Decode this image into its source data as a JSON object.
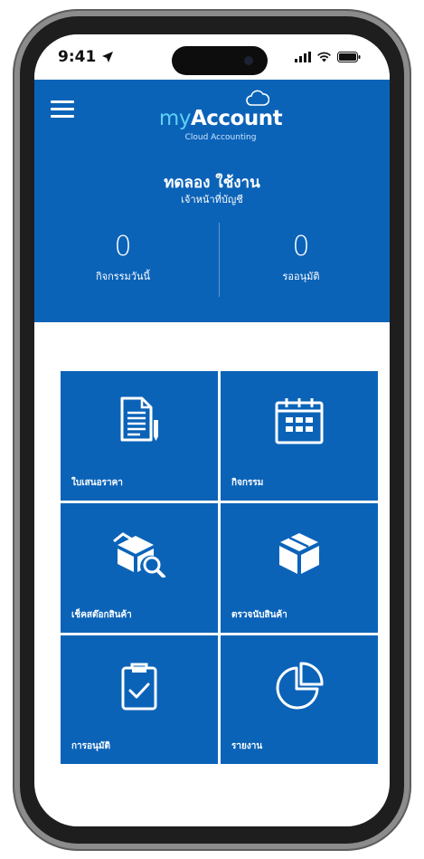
{
  "status_bar": {
    "time": "9:41"
  },
  "logo": {
    "brand_prefix": "my",
    "brand_name": "Account",
    "tagline": "Cloud Accounting"
  },
  "user": {
    "name": "ทดลอง ใช้งาน",
    "role": "เจ้าหน้าที่บัญชี"
  },
  "stats": [
    {
      "value": "0",
      "label": "กิจกรรมวันนี้"
    },
    {
      "value": "0",
      "label": "รออนุมัติ"
    }
  ],
  "menu_tiles": [
    {
      "label": "ใบเสนอราคา",
      "icon": "document-icon"
    },
    {
      "label": "กิจกรรม",
      "icon": "calendar-icon"
    },
    {
      "label": "เช็คสต๊อกสินค้า",
      "icon": "stock-search-icon"
    },
    {
      "label": "ตรวจนับสินค้า",
      "icon": "box-icon"
    },
    {
      "label": "การอนุมัติ",
      "icon": "clipboard-check-icon"
    },
    {
      "label": "รายงาน",
      "icon": "pie-chart-icon"
    }
  ],
  "colors": {
    "primary": "#0b63b8",
    "brand_accent": "#5fd0f5",
    "text_on_primary": "#ffffff"
  }
}
